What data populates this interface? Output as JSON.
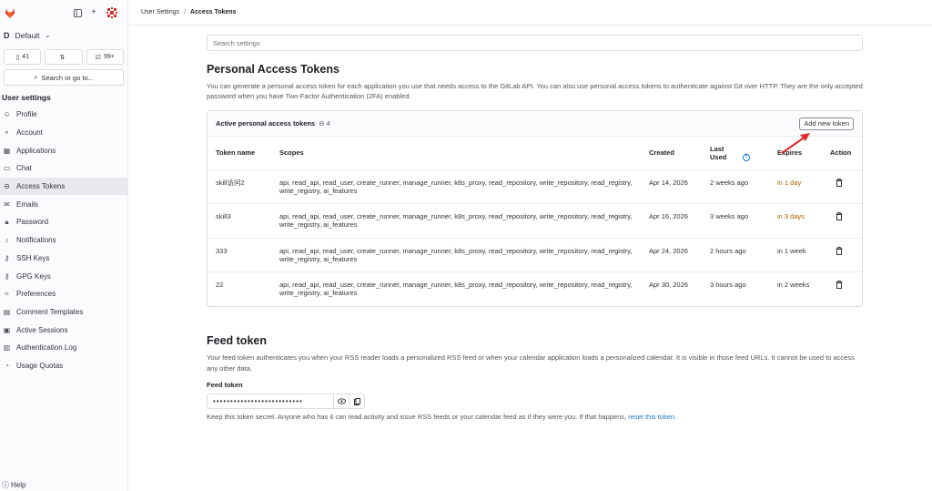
{
  "sidebar": {
    "context_initial": "D",
    "context_name": "Default",
    "counts": {
      "issues": "41",
      "mrs": "",
      "todos": "99+"
    },
    "search_label": "Search or go to...",
    "section_title": "User settings",
    "items": [
      {
        "label": "Profile",
        "icon": "person-icon"
      },
      {
        "label": "Account",
        "icon": "account-icon"
      },
      {
        "label": "Applications",
        "icon": "applications-icon"
      },
      {
        "label": "Chat",
        "icon": "chat-icon"
      },
      {
        "label": "Access Tokens",
        "icon": "token-icon",
        "active": true
      },
      {
        "label": "Emails",
        "icon": "mail-icon"
      },
      {
        "label": "Password",
        "icon": "lock-icon"
      },
      {
        "label": "Notifications",
        "icon": "bell-icon"
      },
      {
        "label": "SSH Keys",
        "icon": "key-icon"
      },
      {
        "label": "GPG Keys",
        "icon": "key-icon"
      },
      {
        "label": "Preferences",
        "icon": "preferences-icon"
      },
      {
        "label": "Comment Templates",
        "icon": "comment-icon"
      },
      {
        "label": "Active Sessions",
        "icon": "sessions-icon"
      },
      {
        "label": "Authentication Log",
        "icon": "log-icon"
      },
      {
        "label": "Usage Quotas",
        "icon": "quota-icon"
      }
    ],
    "help_label": "Help"
  },
  "breadcrumb": {
    "parent": "User Settings",
    "separator": "/",
    "current": "Access Tokens"
  },
  "search": {
    "placeholder": "Search settings"
  },
  "pat": {
    "title": "Personal Access Tokens",
    "description": "You can generate a personal access token for each application you use that needs access to the GitLab API. You can also use personal access tokens to authenticate against Git over HTTP. They are the only accepted password when you have Two-Factor Authentication (2FA) enabled.",
    "card_title": "Active personal access tokens",
    "count": "4",
    "add_button": "Add new token",
    "columns": {
      "name": "Token name",
      "scopes": "Scopes",
      "created": "Created",
      "last_used": "Last Used",
      "expires": "Expires",
      "action": "Action"
    },
    "rows": [
      {
        "name": "skill访问2",
        "scopes": "api, read_api, read_user, create_runner, manage_runner, k8s_proxy, read_repository, write_repository, read_registry, write_registry, ai_features",
        "created": "Apr 14, 2026",
        "last_used": "2 weeks ago",
        "expires": "in 1 day",
        "warn": true
      },
      {
        "name": "skill3",
        "scopes": "api, read_api, read_user, create_runner, manage_runner, k8s_proxy, read_repository, write_repository, read_registry, write_registry, ai_features",
        "created": "Apr 16, 2026",
        "last_used": "3 weeks ago",
        "expires": "in 3 days",
        "warn": true
      },
      {
        "name": "333",
        "scopes": "api, read_api, read_user, create_runner, manage_runner, k8s_proxy, read_repository, write_repository, read_registry, write_registry, ai_features",
        "created": "Apr 24, 2026",
        "last_used": "2 hours ago",
        "expires": "in 1 week",
        "warn": false
      },
      {
        "name": "22",
        "scopes": "api, read_api, read_user, create_runner, manage_runner, k8s_proxy, read_repository, write_repository, read_registry, write_registry, ai_features",
        "created": "Apr 30, 2026",
        "last_used": "3 hours ago",
        "expires": "in 2 weeks",
        "warn": false
      }
    ]
  },
  "feed": {
    "title": "Feed token",
    "description": "Your feed token authenticates you when your RSS reader loads a personalized RSS feed or when your calendar application loads a personalized calendar. It is visible in those feed URLs. It cannot be used to access any other data.",
    "label": "Feed token",
    "masked_value": "••••••••••••••••••••••••••",
    "note_prefix": "Keep this token secret. Anyone who has it can read activity and issue RSS feeds or your calendar feed as if they were you. If that happens,",
    "note_link": "reset this token."
  },
  "colors": {
    "warning": "#ab6100",
    "link": "#1f75cb",
    "arrow": "#e02c2c"
  }
}
